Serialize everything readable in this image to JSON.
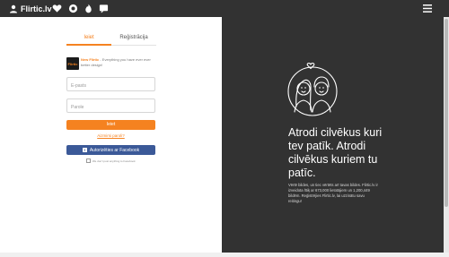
{
  "header": {
    "logo_text": "Flirtic.lv",
    "nav_icons": [
      "user-heart-icon",
      "heart-icon",
      "lens-icon",
      "flame-icon",
      "chat-icon"
    ],
    "menu_icon": "hamburger-menu-icon"
  },
  "auth": {
    "tab_login": "Ieiet",
    "tab_register": "Reģistrācija",
    "app_logo": "Flirtic",
    "app_new": "New Flirtic",
    "app_text": " - Everything you have ever ever better design!",
    "email_placeholder": "E-pasts",
    "password_placeholder": "Parole",
    "login_button": "Ieiet",
    "forgot_link": "Aizmirsi paroli?",
    "facebook_button": "Autorizēties ar Facebook",
    "facebook_note": "We don't post anything to Facebook"
  },
  "promo": {
    "headline": "Atrodi cilvēkus kuri tev patīk. Atrodi cilvēkus kuriem tu patīc.",
    "description": "Vērtē bildes, un tiec vērtēts arī tavas bildes. Flirtic.lv ir izveidota lītiķ ar 673,000 lietotājiem un 1,200,449 bildēm. Reģistrējies Flirtic.lv, lai uzzinātu savu reitingu!"
  },
  "colors": {
    "accent": "#f58220",
    "header_bg": "#323232",
    "facebook": "#3b5998"
  }
}
